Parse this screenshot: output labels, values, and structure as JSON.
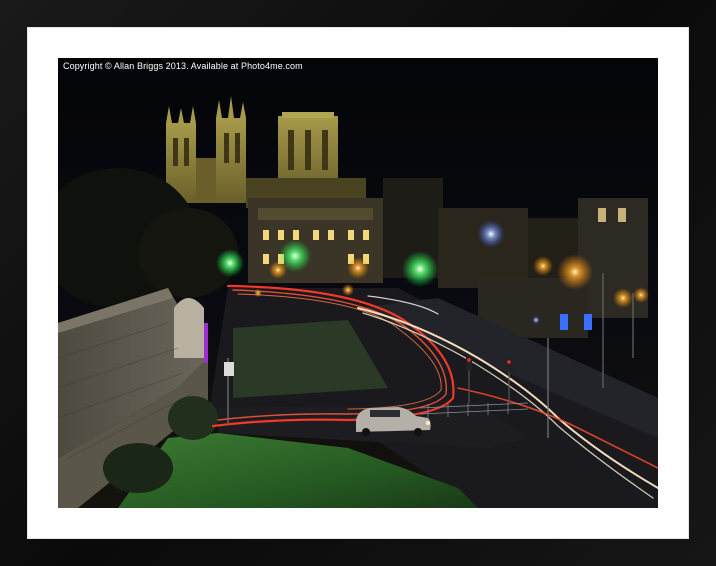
{
  "photo": {
    "copyright": "Copyright © Allan Briggs 2013. Available at Photo4me.com"
  },
  "colors": {
    "frame": "#0d0d0d",
    "mat": "#ffffff",
    "sky": "#05060a",
    "cathedral": "#8a7f3a",
    "light_trail_red": "#ff3b2a",
    "light_trail_white": "#ffe7c4",
    "street_light": "#ffb030",
    "grass": "#2f6a2a",
    "accent_purple": "#a02fd0"
  }
}
